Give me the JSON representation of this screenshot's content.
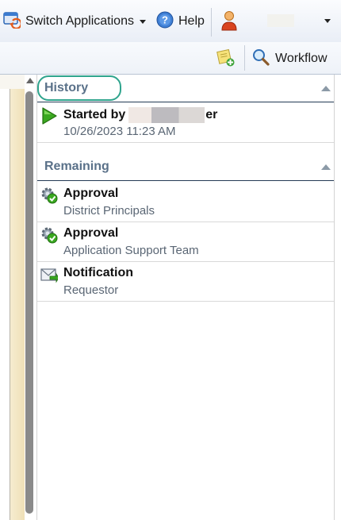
{
  "header": {
    "switch_apps_label": "Switch Applications",
    "help_label": "Help"
  },
  "toolbar": {
    "workflow_label": "Workflow"
  },
  "history": {
    "title": "History",
    "items": [
      {
        "title_prefix": "Started by",
        "title_suffix": "er",
        "subtitle": "10/26/2023 11:23 AM",
        "icon": "play-icon"
      }
    ]
  },
  "remaining": {
    "title": "Remaining",
    "items": [
      {
        "title": "Approval",
        "subtitle": "District Principals",
        "icon": "approval-gear-check-icon"
      },
      {
        "title": "Approval",
        "subtitle": "Application Support Team",
        "icon": "approval-gear-check-icon"
      },
      {
        "title": "Notification",
        "subtitle": "Requestor",
        "icon": "envelope-icon"
      }
    ]
  },
  "colors": {
    "section_title": "#5a7189",
    "highlight_ring": "#2fa48d",
    "play_green": "#3aa820"
  }
}
